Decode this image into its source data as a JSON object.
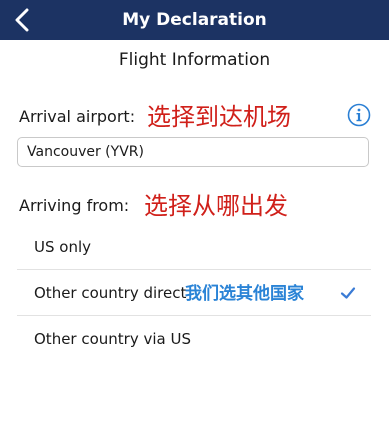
{
  "header": {
    "title": "My Declaration"
  },
  "section_title": "Flight Information",
  "arrival": {
    "label": "Arrival airport:",
    "annotation": "选择到达机场",
    "value": "Vancouver (YVR)"
  },
  "arriving_from": {
    "label": "Arriving from:",
    "annotation": "选择从哪出发",
    "options": [
      {
        "label": "US only",
        "selected": false
      },
      {
        "label": "Other country direct",
        "selected": true
      },
      {
        "label": "Other country via US",
        "selected": false
      }
    ],
    "selected_annotation": "我们选其他国家"
  },
  "colors": {
    "navbar": "#1c3363",
    "annotation_red": "#d0201a",
    "annotation_blue": "#2a83d6",
    "checkmark": "#3a7bd5",
    "info_icon": "#2a7fd4"
  },
  "icons": [
    "chevron-left-icon",
    "info-icon",
    "checkmark-icon"
  ]
}
